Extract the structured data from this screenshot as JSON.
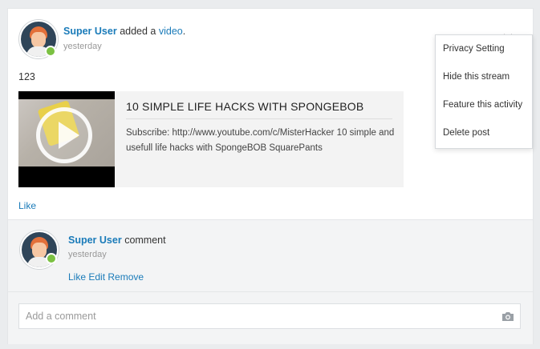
{
  "post": {
    "author": "Super User",
    "action": "added a",
    "object": "video",
    "period": ".",
    "time": "yesterday",
    "text": "123",
    "like": "Like"
  },
  "menu": {
    "items": [
      "Privacy Setting",
      "Hide this stream",
      "Feature this activity",
      "Delete post"
    ]
  },
  "media": {
    "title": "10 SIMPLE LIFE HACKS WITH SPONGEBOB",
    "description": "Subscribe: http://www.youtube.com/c/MisterHacker 10 simple and usefull life hacks with SpongeBOB SquarePants"
  },
  "comment": {
    "author": "Super User",
    "text": "comment",
    "time": "yesterday",
    "actions": [
      "Like",
      "Edit",
      "Remove"
    ]
  },
  "composer": {
    "placeholder": "Add a comment"
  },
  "icons": {
    "menu_toggle": "chevron-down-icon",
    "camera": "camera-icon",
    "play": "play-icon"
  },
  "colors": {
    "link": "#1a7bb9",
    "online": "#7bc142",
    "background": "#eaecee"
  }
}
